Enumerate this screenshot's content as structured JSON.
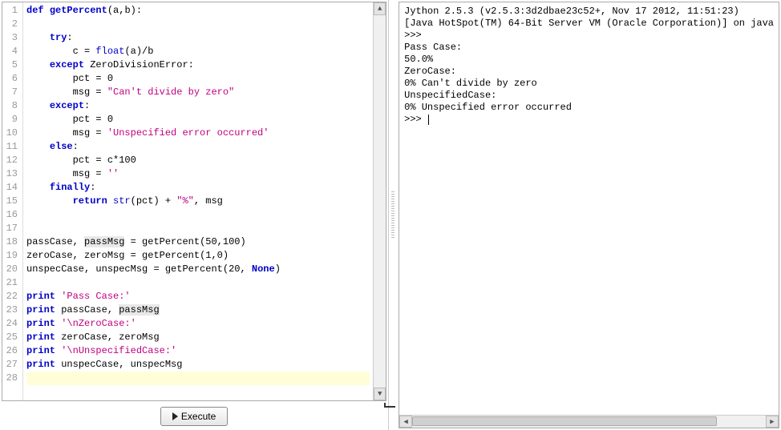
{
  "editor": {
    "line_count": 28,
    "current_line": 28,
    "lines": [
      {
        "n": 1,
        "tokens": [
          [
            "kw",
            "def"
          ],
          [
            "sp",
            " "
          ],
          [
            "fn",
            "getPercent"
          ],
          [
            "op",
            "("
          ],
          [
            "id",
            "a"
          ],
          [
            "op",
            ","
          ],
          [
            "id",
            "b"
          ],
          [
            "op",
            "):"
          ]
        ]
      },
      {
        "n": 2,
        "tokens": []
      },
      {
        "n": 3,
        "tokens": [
          [
            "sp",
            "    "
          ],
          [
            "kw",
            "try"
          ],
          [
            "op",
            ":"
          ]
        ]
      },
      {
        "n": 4,
        "tokens": [
          [
            "sp",
            "        "
          ],
          [
            "id",
            "c"
          ],
          [
            "sp",
            " "
          ],
          [
            "op",
            "="
          ],
          [
            "sp",
            " "
          ],
          [
            "builtin",
            "float"
          ],
          [
            "op",
            "("
          ],
          [
            "id",
            "a"
          ],
          [
            "op",
            ")/"
          ],
          [
            "id",
            "b"
          ]
        ]
      },
      {
        "n": 5,
        "tokens": [
          [
            "sp",
            "    "
          ],
          [
            "kw",
            "except"
          ],
          [
            "sp",
            " "
          ],
          [
            "exc",
            "ZeroDivisionError"
          ],
          [
            "op",
            ":"
          ]
        ]
      },
      {
        "n": 6,
        "tokens": [
          [
            "sp",
            "        "
          ],
          [
            "id",
            "pct"
          ],
          [
            "sp",
            " "
          ],
          [
            "op",
            "="
          ],
          [
            "sp",
            " "
          ],
          [
            "num",
            "0"
          ]
        ]
      },
      {
        "n": 7,
        "tokens": [
          [
            "sp",
            "        "
          ],
          [
            "id",
            "msg"
          ],
          [
            "sp",
            " "
          ],
          [
            "op",
            "="
          ],
          [
            "sp",
            " "
          ],
          [
            "str",
            "\"Can't divide by zero\""
          ]
        ]
      },
      {
        "n": 8,
        "tokens": [
          [
            "sp",
            "    "
          ],
          [
            "kw",
            "except"
          ],
          [
            "op",
            ":"
          ]
        ]
      },
      {
        "n": 9,
        "tokens": [
          [
            "sp",
            "        "
          ],
          [
            "id",
            "pct"
          ],
          [
            "sp",
            " "
          ],
          [
            "op",
            "="
          ],
          [
            "sp",
            " "
          ],
          [
            "num",
            "0"
          ]
        ]
      },
      {
        "n": 10,
        "tokens": [
          [
            "sp",
            "        "
          ],
          [
            "id",
            "msg"
          ],
          [
            "sp",
            " "
          ],
          [
            "op",
            "="
          ],
          [
            "sp",
            " "
          ],
          [
            "str",
            "'Unspecified error occurred'"
          ]
        ]
      },
      {
        "n": 11,
        "tokens": [
          [
            "sp",
            "    "
          ],
          [
            "kw",
            "else"
          ],
          [
            "op",
            ":"
          ]
        ]
      },
      {
        "n": 12,
        "tokens": [
          [
            "sp",
            "        "
          ],
          [
            "id",
            "pct"
          ],
          [
            "sp",
            " "
          ],
          [
            "op",
            "="
          ],
          [
            "sp",
            " "
          ],
          [
            "id",
            "c"
          ],
          [
            "op",
            "*"
          ],
          [
            "num",
            "100"
          ]
        ]
      },
      {
        "n": 13,
        "tokens": [
          [
            "sp",
            "        "
          ],
          [
            "id",
            "msg"
          ],
          [
            "sp",
            " "
          ],
          [
            "op",
            "="
          ],
          [
            "sp",
            " "
          ],
          [
            "str",
            "''"
          ]
        ]
      },
      {
        "n": 14,
        "tokens": [
          [
            "sp",
            "    "
          ],
          [
            "kw",
            "finally"
          ],
          [
            "op",
            ":"
          ]
        ]
      },
      {
        "n": 15,
        "tokens": [
          [
            "sp",
            "        "
          ],
          [
            "kw",
            "return"
          ],
          [
            "sp",
            " "
          ],
          [
            "builtin",
            "str"
          ],
          [
            "op",
            "("
          ],
          [
            "id",
            "pct"
          ],
          [
            "op",
            ")"
          ],
          [
            "sp",
            " "
          ],
          [
            "op",
            "+"
          ],
          [
            "sp",
            " "
          ],
          [
            "str",
            "\"%\""
          ],
          [
            "op",
            ","
          ],
          [
            "sp",
            " "
          ],
          [
            "id",
            "msg"
          ]
        ]
      },
      {
        "n": 16,
        "tokens": []
      },
      {
        "n": 17,
        "tokens": []
      },
      {
        "n": 18,
        "tokens": [
          [
            "id",
            "passCase"
          ],
          [
            "op",
            ","
          ],
          [
            "sp",
            " "
          ],
          [
            "var-hl",
            "passMsg"
          ],
          [
            "sp",
            " "
          ],
          [
            "op",
            "="
          ],
          [
            "sp",
            " "
          ],
          [
            "id",
            "getPercent"
          ],
          [
            "op",
            "("
          ],
          [
            "num",
            "50"
          ],
          [
            "op",
            ","
          ],
          [
            "num",
            "100"
          ],
          [
            "op",
            ")"
          ]
        ]
      },
      {
        "n": 19,
        "tokens": [
          [
            "id",
            "zeroCase"
          ],
          [
            "op",
            ","
          ],
          [
            "sp",
            " "
          ],
          [
            "id",
            "zeroMsg"
          ],
          [
            "sp",
            " "
          ],
          [
            "op",
            "="
          ],
          [
            "sp",
            " "
          ],
          [
            "id",
            "getPercent"
          ],
          [
            "op",
            "("
          ],
          [
            "num",
            "1"
          ],
          [
            "op",
            ","
          ],
          [
            "num",
            "0"
          ],
          [
            "op",
            ")"
          ]
        ]
      },
      {
        "n": 20,
        "tokens": [
          [
            "id",
            "unspecCase"
          ],
          [
            "op",
            ","
          ],
          [
            "sp",
            " "
          ],
          [
            "id",
            "unspecMsg"
          ],
          [
            "sp",
            " "
          ],
          [
            "op",
            "="
          ],
          [
            "sp",
            " "
          ],
          [
            "id",
            "getPercent"
          ],
          [
            "op",
            "("
          ],
          [
            "num",
            "20"
          ],
          [
            "op",
            ","
          ],
          [
            "sp",
            " "
          ],
          [
            "kw",
            "None"
          ],
          [
            "op",
            ")"
          ]
        ]
      },
      {
        "n": 21,
        "tokens": []
      },
      {
        "n": 22,
        "tokens": [
          [
            "kw",
            "print"
          ],
          [
            "sp",
            " "
          ],
          [
            "str",
            "'Pass Case:'"
          ]
        ]
      },
      {
        "n": 23,
        "tokens": [
          [
            "kw",
            "print"
          ],
          [
            "sp",
            " "
          ],
          [
            "id",
            "passCase"
          ],
          [
            "op",
            ","
          ],
          [
            "sp",
            " "
          ],
          [
            "var-hl",
            "passMsg"
          ]
        ]
      },
      {
        "n": 24,
        "tokens": [
          [
            "kw",
            "print"
          ],
          [
            "sp",
            " "
          ],
          [
            "str",
            "'\\nZeroCase:'"
          ]
        ]
      },
      {
        "n": 25,
        "tokens": [
          [
            "kw",
            "print"
          ],
          [
            "sp",
            " "
          ],
          [
            "id",
            "zeroCase"
          ],
          [
            "op",
            ","
          ],
          [
            "sp",
            " "
          ],
          [
            "id",
            "zeroMsg"
          ]
        ]
      },
      {
        "n": 26,
        "tokens": [
          [
            "kw",
            "print"
          ],
          [
            "sp",
            " "
          ],
          [
            "str",
            "'\\nUnspecifiedCase:'"
          ]
        ]
      },
      {
        "n": 27,
        "tokens": [
          [
            "kw",
            "print"
          ],
          [
            "sp",
            " "
          ],
          [
            "id",
            "unspecCase"
          ],
          [
            "op",
            ","
          ],
          [
            "sp",
            " "
          ],
          [
            "id",
            "unspecMsg"
          ]
        ]
      },
      {
        "n": 28,
        "tokens": []
      }
    ]
  },
  "toolbar": {
    "execute_label": "Execute"
  },
  "console": {
    "lines": [
      "Jython 2.5.3 (v2.5.3:3d2dbae23c52+, Nov 17 2012, 11:51:23)",
      "[Java HotSpot(TM) 64-Bit Server VM (Oracle Corporation)] on java",
      "",
      ">>>",
      "Pass Case:",
      "50.0%",
      "",
      "ZeroCase:",
      "0% Can't divide by zero",
      "",
      "UnspecifiedCase:",
      "0% Unspecified error occurred",
      ">>> "
    ]
  }
}
